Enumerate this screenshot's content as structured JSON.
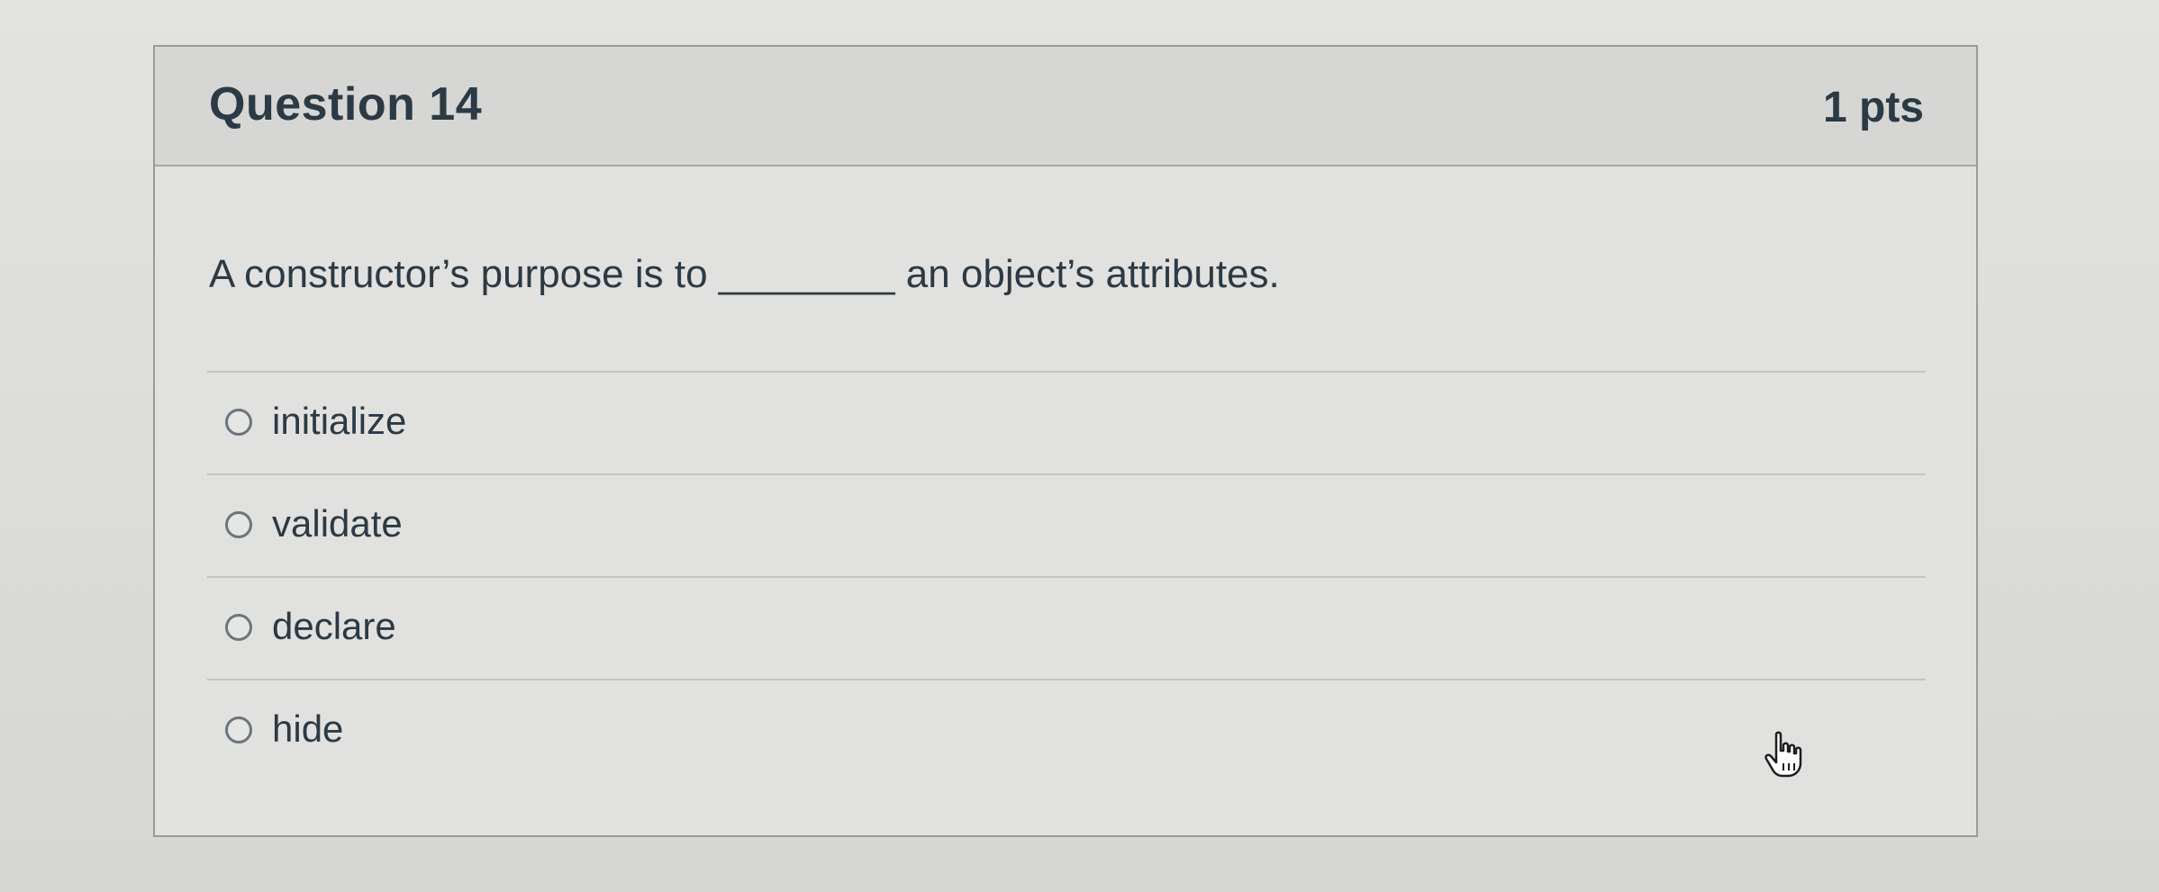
{
  "question": {
    "title": "Question 14",
    "points": "1 pts",
    "text": "A constructor’s purpose is to ________ an object’s attributes.",
    "answers": [
      {
        "label": "initialize",
        "selected": false
      },
      {
        "label": "validate",
        "selected": false
      },
      {
        "label": "declare",
        "selected": false
      },
      {
        "label": "hide",
        "selected": false
      }
    ]
  },
  "icons": {
    "radio": "radio-button-icon",
    "cursor": "hand-pointer-icon"
  },
  "colors": {
    "text": "#2b3a44",
    "header_bg": "#d6d6d4",
    "card_border": "#9a9a98"
  }
}
